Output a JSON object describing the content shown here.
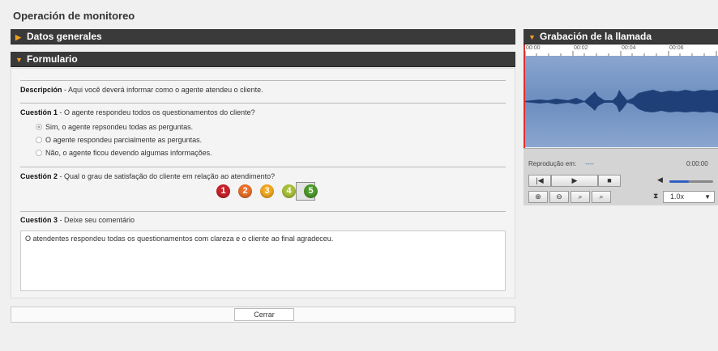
{
  "page": {
    "title": "Operación de monitoreo"
  },
  "sections": {
    "general": "Datos generales",
    "form": "Formulario",
    "recording": "Grabación de la llamada"
  },
  "form": {
    "description_label": "Descripción",
    "description_text": " - Aqui você deverá informar como o agente atendeu o cliente.",
    "q1": {
      "label": "Cuestión 1",
      "text": " - O agente respondeu todos os questionamentos do cliente?",
      "options": [
        "Sim, o agente repsondeu todas as perguntas.",
        "O agente respondeu parcialmente as perguntas.",
        "Não, o agente ficou devendo algumas informações."
      ],
      "selected_index": 0
    },
    "q2": {
      "label": "Cuestión 2",
      "text": " - Qual o grau de satisfação do cliente em relação ao atendimento?",
      "scores": [
        {
          "value": "1",
          "color": "#c8222a"
        },
        {
          "value": "2",
          "color": "#e8702a"
        },
        {
          "value": "3",
          "color": "#f0a820"
        },
        {
          "value": "4",
          "color": "#a8c038"
        },
        {
          "value": "5",
          "color": "#4c9a2a"
        }
      ],
      "selected": "5"
    },
    "q3": {
      "label": "Cuestión 3",
      "text": " - Deixe seu comentário",
      "comment": "O atendentes respondeu todas os questionamentos com clareza e o cliente ao final agradeceu."
    },
    "close_button": "Cerrar"
  },
  "player": {
    "timeline_ticks": [
      "00:00",
      "00:02",
      "00:04",
      "00:06"
    ],
    "playback_label": "Reprodução em:",
    "playback_value": "----",
    "time": "0:00:00",
    "speed": "1.0x",
    "volume_level": 0.45,
    "icons": [
      "rewind-icon",
      "play-icon",
      "stop-icon",
      "volume-icon",
      "zoom-in-icon",
      "zoom-out-icon",
      "zoom-selection-icon",
      "zoom-reset-icon",
      "speed-icon"
    ]
  }
}
